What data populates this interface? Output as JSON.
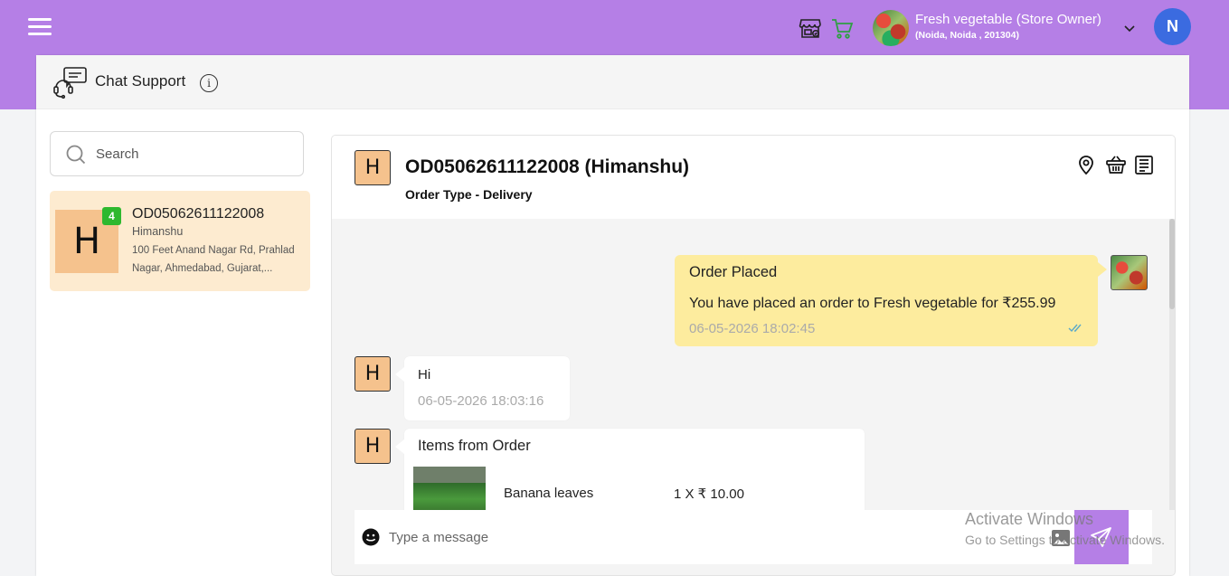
{
  "header": {
    "store_name": "Fresh vegetable (Store Owner)",
    "store_address": "(Noida, Noida , 201304)",
    "user_initial": "N"
  },
  "panel": {
    "title": "Chat Support",
    "info_glyph": "i"
  },
  "search": {
    "placeholder": "Search"
  },
  "conversation_list": [
    {
      "avatar_initial": "H",
      "unread_count": "4",
      "order_id": "OD05062611122008",
      "customer_name": "Himanshu",
      "address": "100 Feet Anand Nagar Rd, Prahlad Nagar, Ahmedabad, Gujarat,..."
    }
  ],
  "chat": {
    "avatar_initial": "H",
    "title": "OD05062611122008 (Himanshu)",
    "subtitle": "Order Type - Delivery",
    "header_icons": [
      "location-pin-icon",
      "basket-icon",
      "receipt-icon"
    ],
    "messages": {
      "order_placed": {
        "title": "Order Placed",
        "text": "You have placed an order to Fresh vegetable for ₹255.99",
        "time": "06-05-2026 18:02:45"
      },
      "hi": {
        "avatar_initial": "H",
        "text": "Hi",
        "time": "06-05-2026 18:03:16"
      },
      "items": {
        "avatar_initial": "H",
        "title": "Items from Order",
        "item_name": "Banana leaves",
        "item_qty": "1 X ₹ 10.00"
      }
    },
    "composer": {
      "placeholder": "Type a message"
    }
  },
  "watermark": {
    "line1": "Activate Windows",
    "line2": "Go to Settings to activate Windows."
  },
  "colors": {
    "brand": "#b57fe6",
    "avatar_peach": "#f5c28d",
    "outgoing_bubble": "#fdec9e",
    "selected_conversation": "#fdebd0",
    "badge_green": "#2eb82e",
    "user_avatar": "#3b6be0"
  }
}
